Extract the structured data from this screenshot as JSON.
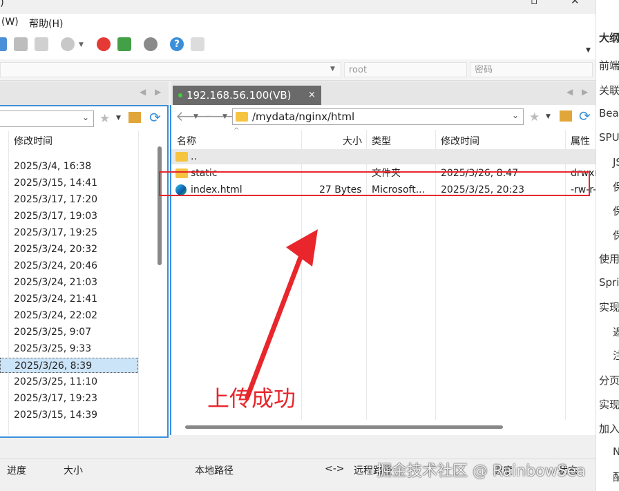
{
  "menu": {
    "items": [
      "(W)",
      "帮助(H)"
    ]
  },
  "connection": {
    "user_placeholder": "root",
    "password_placeholder": "密码"
  },
  "left_pane": {
    "col_modified": "修改时间",
    "times": [
      "2025/3/4, 16:38",
      "2025/3/15, 14:41",
      "2025/3/17, 17:20",
      "2025/3/17, 19:03",
      "2025/3/17, 19:25",
      "2025/3/24, 20:32",
      "2025/3/24, 20:46",
      "2025/3/24, 21:03",
      "2025/3/24, 21:41",
      "2025/3/24, 22:02",
      "2025/3/25, 9:07",
      "2025/3/25, 9:33",
      "2025/3/26, 8:39",
      "2025/3/25, 11:10",
      "2025/3/17, 19:23",
      "2025/3/15, 14:39"
    ],
    "selected_index": 12
  },
  "right_pane": {
    "tab_label": "192.168.56.100(VB)",
    "tab_close": "×",
    "path": "/mydata/nginx/html",
    "columns": {
      "name": "名称",
      "size": "大小",
      "type": "类型",
      "modified": "修改时间",
      "attr": "属性"
    },
    "files": [
      {
        "name": "..",
        "size": "",
        "type": "",
        "modified": "",
        "attr": ""
      },
      {
        "name": "static",
        "size": "",
        "type": "文件夹",
        "modified": "2025/3/26, 8:47",
        "attr": "drwxr"
      },
      {
        "name": "index.html",
        "size": "27 Bytes",
        "type": "Microsoft...",
        "modified": "2025/3/25, 20:23",
        "attr": "-rw-r-"
      }
    ]
  },
  "annotation": {
    "text": "上传成功",
    "color": "#e8262b"
  },
  "status_bar": {
    "progress": "进度",
    "size": "大小",
    "local_path": "本地路径",
    "arrow": "<->",
    "remote_path": "远程路径",
    "speed": "速度",
    "status": "状态"
  },
  "watermark": "掘金技术社区 @ RainbowSea",
  "right_sidebar": [
    "大纲",
    "前端",
    "关联",
    "Bean",
    "SPU",
    "JS",
    "保",
    "保",
    "保",
    "使用",
    "Spri",
    "实现",
    "返",
    "注",
    "分页",
    "实现",
    "加入",
    "N",
    "配"
  ]
}
